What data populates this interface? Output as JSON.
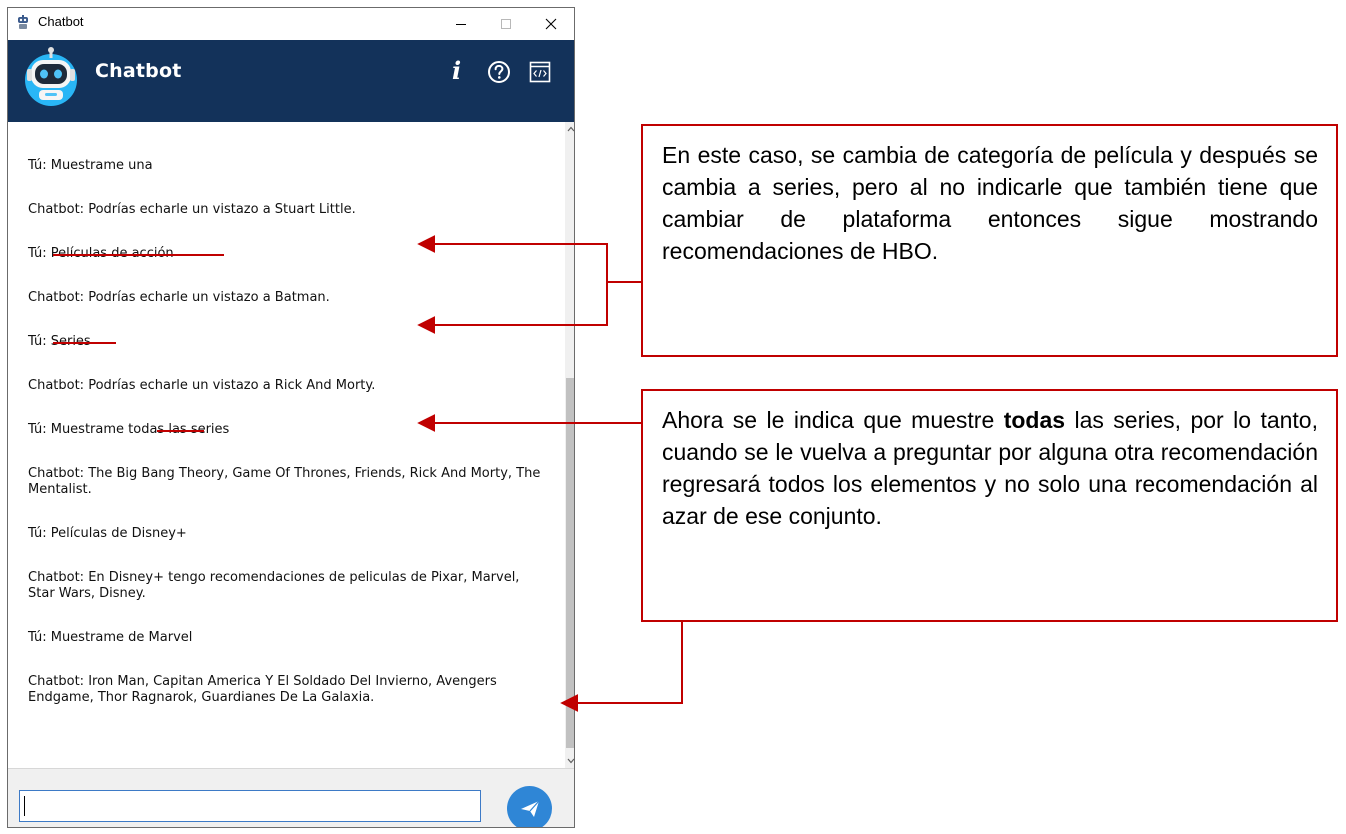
{
  "window": {
    "title": "Chatbot",
    "minimize_glyph": "–",
    "maximize_glyph": "☐",
    "close_glyph": "✕"
  },
  "header": {
    "title": "Chatbot",
    "info_glyph": "i",
    "icons": [
      "robot-avatar-icon",
      "info-icon",
      "help-icon",
      "code-icon"
    ]
  },
  "chat": {
    "messages": [
      {
        "prefix": "Tú:",
        "text": " Muestrame una"
      },
      {
        "prefix": "Chatbot:",
        "text": " Podrías echarle un vistazo a Stuart Little."
      },
      {
        "prefix": "Tú:",
        "text": " Películas de acción"
      },
      {
        "prefix": "Chatbot:",
        "text": " Podrías echarle un vistazo a Batman."
      },
      {
        "prefix": "Tú:",
        "text": " Series"
      },
      {
        "prefix": "Chatbot:",
        "text": " Podrías echarle un vistazo a Rick And Morty."
      },
      {
        "prefix": "Tú:",
        "text": " Muestrame todas las series"
      },
      {
        "prefix": "Chatbot:",
        "text": " The Big Bang Theory, Game Of Thrones, Friends, Rick And Morty, The Mentalist."
      },
      {
        "prefix": "Tú:",
        "text": " Películas de Disney+"
      },
      {
        "prefix": "Chatbot:",
        "text": " En Disney+ tengo recomendaciones de peliculas de Pixar, Marvel, Star Wars, Disney."
      },
      {
        "prefix": "Tú:",
        "text": " Muestrame de Marvel"
      },
      {
        "prefix": "Chatbot:",
        "text": " Iron Man, Capitan America Y El Soldado Del Invierno, Avengers Endgame, Thor Ragnarok, Guardianes De La Galaxia."
      }
    ]
  },
  "input": {
    "value": "",
    "placeholder": ""
  },
  "annotations": {
    "note_1": "En este caso, se cambia de categoría de película y después se cambia a series, pero al no indicarle que también tiene que cambiar de plataforma entonces sigue mostrando recomendaciones de HBO.",
    "note_2_before": "Ahora se le indica que muestre ",
    "note_2_bold": "todas",
    "note_2_after": " las series, por lo tanto, cuando se le vuelva a preguntar por alguna otra recomendación regresará todos los elementos y no solo una recomendación al azar de ese conjunto.",
    "color": "#c00000"
  },
  "colors": {
    "header_bg": "#13325a",
    "send_button": "#2f86d6",
    "input_border": "#3d7ac6"
  }
}
